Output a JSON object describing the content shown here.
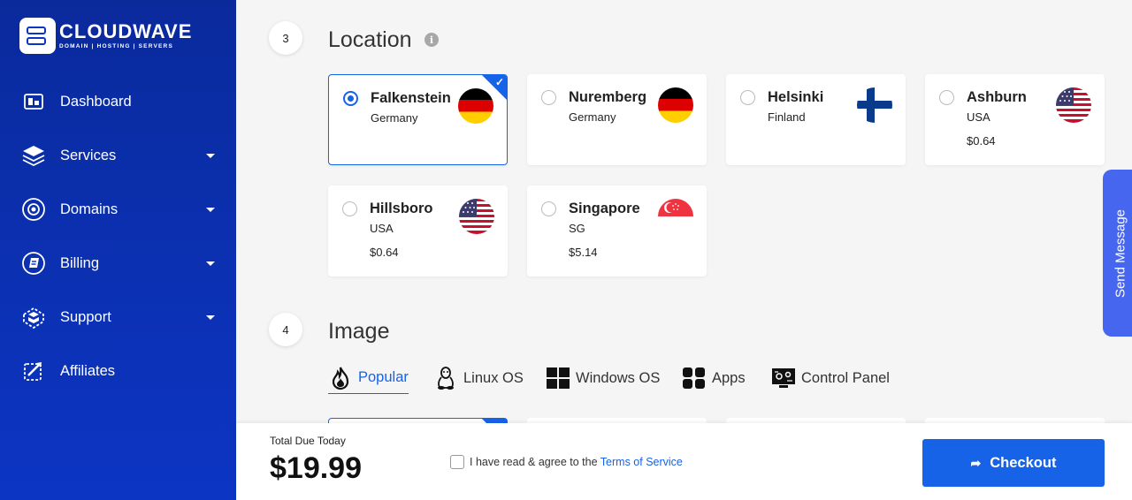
{
  "brand": {
    "name": "CLOUDWAVE",
    "tagline": "DOMAIN | HOSTING | SERVERS",
    "primary_color": "#0c35c4",
    "accent_color": "#1763e8"
  },
  "sidebar": {
    "items": [
      {
        "label": "Dashboard",
        "icon": "dashboard-icon",
        "has_dropdown": false
      },
      {
        "label": "Services",
        "icon": "services-icon",
        "has_dropdown": true
      },
      {
        "label": "Domains",
        "icon": "globe-icon",
        "has_dropdown": true
      },
      {
        "label": "Billing",
        "icon": "billing-icon",
        "has_dropdown": true
      },
      {
        "label": "Support",
        "icon": "support-icon",
        "has_dropdown": true
      },
      {
        "label": "Affiliates",
        "icon": "affiliates-icon",
        "has_dropdown": false
      }
    ]
  },
  "location": {
    "step": "3",
    "title": "Location",
    "info_icon": "info-icon",
    "options": [
      {
        "name": "Falkenstein",
        "country": "Germany",
        "price": "",
        "flag": "germany-flag-icon",
        "selected": true
      },
      {
        "name": "Nuremberg",
        "country": "Germany",
        "price": "",
        "flag": "germany-flag-icon",
        "selected": false
      },
      {
        "name": "Helsinki",
        "country": "Finland",
        "price": "",
        "flag": "finland-flag-icon",
        "selected": false
      },
      {
        "name": "Ashburn",
        "country": "USA",
        "price": "$0.64",
        "flag": "usa-flag-icon",
        "selected": false
      },
      {
        "name": "Hillsboro",
        "country": "USA",
        "price": "$0.64",
        "flag": "usa-flag-icon",
        "selected": false
      },
      {
        "name": "Singapore",
        "country": "SG",
        "price": "$5.14",
        "flag": "singapore-flag-icon",
        "selected": false
      }
    ]
  },
  "image": {
    "step": "4",
    "title": "Image",
    "tabs": [
      {
        "label": "Popular",
        "icon": "flame-icon",
        "active": true
      },
      {
        "label": "Linux OS",
        "icon": "linux-icon",
        "active": false
      },
      {
        "label": "Windows OS",
        "icon": "windows-icon",
        "active": false
      },
      {
        "label": "Apps",
        "icon": "apps-icon",
        "active": false
      },
      {
        "label": "Control Panel",
        "icon": "control-panel-icon",
        "active": false
      }
    ]
  },
  "send_message": {
    "label": "Send Message"
  },
  "footer": {
    "due_label": "Total Due Today",
    "due_amount": "$19.99",
    "agree_text": "I have read & agree to the ",
    "tos_link": "Terms of Service",
    "agree_checked": false,
    "checkout_label": "Checkout"
  }
}
